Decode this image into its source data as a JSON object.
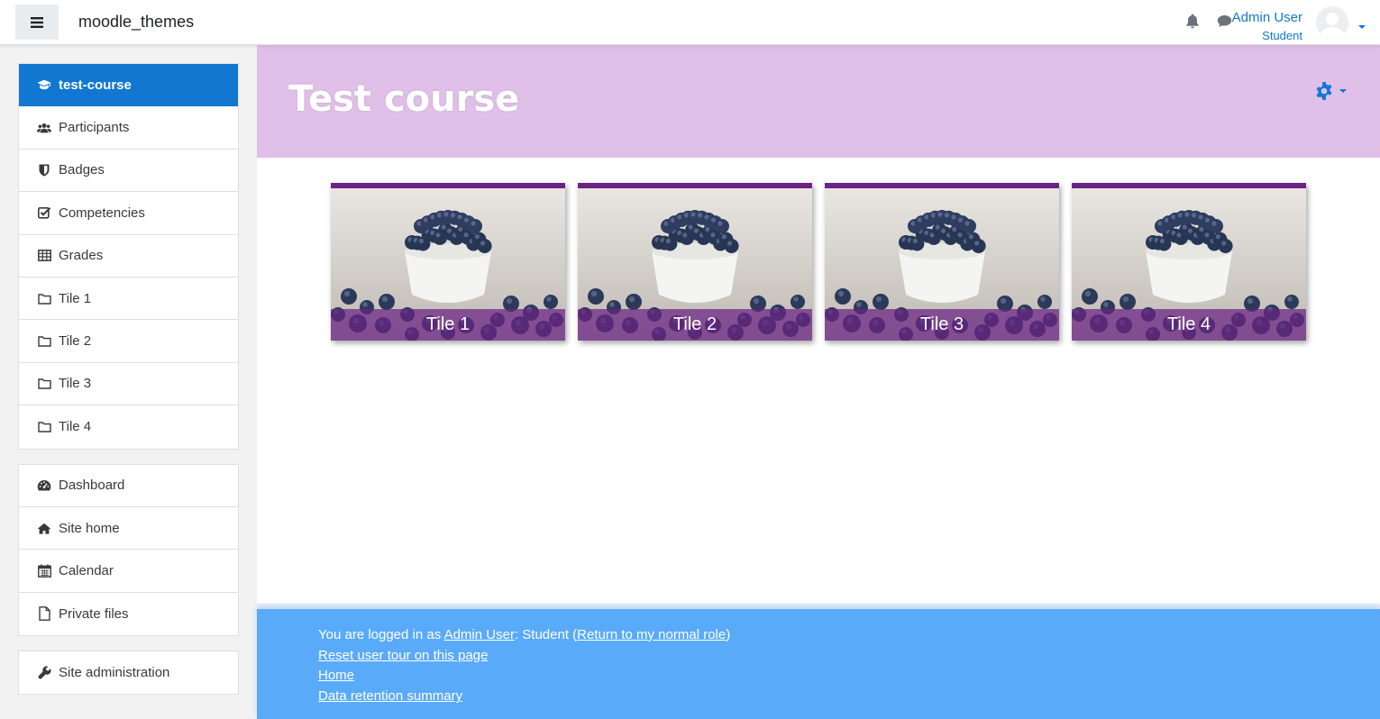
{
  "navbar": {
    "brand": "moodle_themes",
    "user_name": "Admin User",
    "user_role": "Student"
  },
  "drawer": {
    "course_items": [
      {
        "label": "test-course",
        "icon": "graduation-cap-icon",
        "active": true
      },
      {
        "label": "Participants",
        "icon": "users-icon"
      },
      {
        "label": "Badges",
        "icon": "shield-icon"
      },
      {
        "label": "Competencies",
        "icon": "check-square-icon"
      },
      {
        "label": "Grades",
        "icon": "table-icon"
      },
      {
        "label": "Tile 1",
        "icon": "folder-icon"
      },
      {
        "label": "Tile 2",
        "icon": "folder-icon"
      },
      {
        "label": "Tile 3",
        "icon": "folder-icon"
      },
      {
        "label": "Tile 4",
        "icon": "folder-icon"
      }
    ],
    "site_items": [
      {
        "label": "Dashboard",
        "icon": "dashboard-icon"
      },
      {
        "label": "Site home",
        "icon": "home-icon"
      },
      {
        "label": "Calendar",
        "icon": "calendar-icon"
      },
      {
        "label": "Private files",
        "icon": "file-icon"
      }
    ],
    "admin_items": [
      {
        "label": "Site administration",
        "icon": "wrench-icon"
      }
    ]
  },
  "header": {
    "title": "Test course",
    "background": "#e0bfe8"
  },
  "tiles": [
    {
      "label": "Tile 1"
    },
    {
      "label": "Tile 2"
    },
    {
      "label": "Tile 3"
    },
    {
      "label": "Tile 4"
    }
  ],
  "footer": {
    "logged_in_prefix": "You are logged in as ",
    "user_link": "Admin User",
    "role_text": ": Student (",
    "return_link": "Return to my normal role",
    "close_paren": ")",
    "reset_tour": "Reset user tour on this page",
    "home": "Home",
    "data_retention": "Data retention summary"
  },
  "colors": {
    "accent": "#1177d1",
    "tile_border": "#6a2382",
    "footer_bg": "#5aaafa"
  }
}
